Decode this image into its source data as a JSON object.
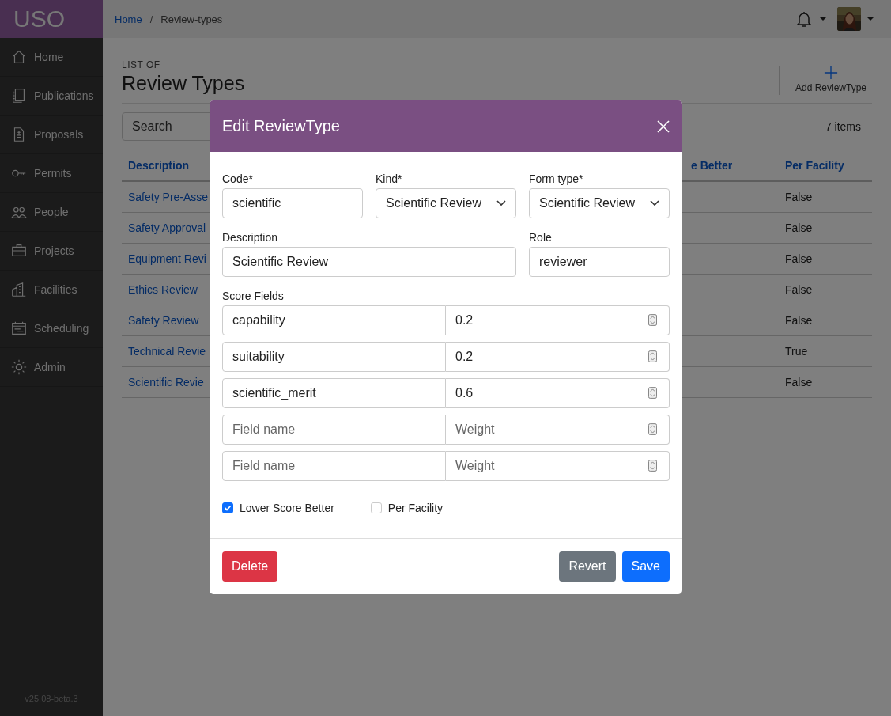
{
  "app": {
    "logo": "USO",
    "version": "v25.08-beta.3"
  },
  "sidebar": {
    "items": [
      {
        "label": "Home"
      },
      {
        "label": "Publications"
      },
      {
        "label": "Proposals"
      },
      {
        "label": "Permits"
      },
      {
        "label": "People"
      },
      {
        "label": "Projects"
      },
      {
        "label": "Facilities"
      },
      {
        "label": "Scheduling"
      },
      {
        "label": "Admin"
      }
    ]
  },
  "breadcrumb": {
    "separator": "/",
    "items": [
      {
        "label": "Home",
        "link": true
      },
      {
        "label": "Review-types",
        "link": false
      }
    ]
  },
  "header": {
    "overline": "LIST OF",
    "title": "Review Types",
    "add_button": "Add ReviewType"
  },
  "toolbar": {
    "search": {
      "placeholder": "Search"
    },
    "count": "7 items"
  },
  "table": {
    "columns": [
      "Description",
      "e Better",
      "Per Facility"
    ],
    "rows": [
      {
        "description": "Safety Pre-Asse",
        "per_facility": "False"
      },
      {
        "description": "Safety Approval",
        "per_facility": "False"
      },
      {
        "description": "Equipment Revi",
        "per_facility": "False"
      },
      {
        "description": "Ethics Review",
        "per_facility": "False"
      },
      {
        "description": "Safety Review",
        "per_facility": "False"
      },
      {
        "description": "Technical Revie",
        "per_facility": "True"
      },
      {
        "description": "Scientific Revie",
        "per_facility": "False"
      }
    ]
  },
  "modal": {
    "title": "Edit ReviewType",
    "field_rows": [
      [
        {
          "label": "Code*",
          "value": "scientific",
          "kind": "text"
        },
        {
          "label": "Kind*",
          "value": "Scientific Review",
          "kind": "select"
        },
        {
          "label": "Form type*",
          "value": "Scientific Review",
          "kind": "select"
        }
      ],
      [
        {
          "label": "Description",
          "value": "Scientific Review",
          "kind": "text"
        },
        {
          "label": "Role",
          "value": "reviewer",
          "kind": "text"
        }
      ]
    ],
    "score_label": "Score Fields",
    "score_fields": [
      {
        "name": "capability",
        "weight": "0.2"
      },
      {
        "name": "suitability",
        "weight": "0.2"
      },
      {
        "name": "scientific_merit",
        "weight": "0.6"
      },
      {
        "name_placeholder": "Field name",
        "weight_placeholder": "Weight"
      },
      {
        "name_placeholder": "Field name",
        "weight_placeholder": "Weight"
      }
    ],
    "checkboxes": [
      {
        "label": "Lower Score Better",
        "checked": true
      },
      {
        "label": "Per Facility",
        "checked": false
      }
    ],
    "buttons": [
      {
        "label": "Delete",
        "kind": "danger"
      },
      {
        "label": "Revert",
        "kind": "secondary"
      },
      {
        "label": "Save",
        "kind": "primary"
      }
    ]
  }
}
